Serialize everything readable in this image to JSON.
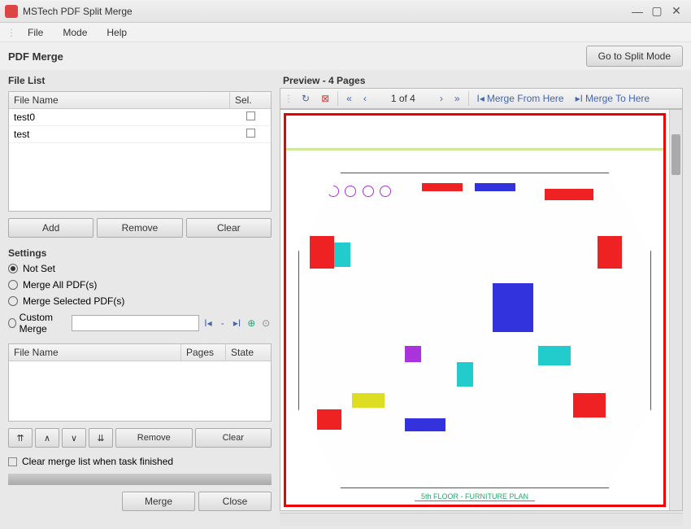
{
  "window": {
    "title": "MSTech PDF Split Merge"
  },
  "menu": {
    "file": "File",
    "mode": "Mode",
    "help": "Help"
  },
  "modebar": {
    "title": "PDF Merge",
    "split_button": "Go to Split Mode"
  },
  "filelist": {
    "heading": "File List",
    "col_name": "File Name",
    "col_sel": "Sel.",
    "rows": [
      {
        "name": "test0",
        "sel": false
      },
      {
        "name": "test",
        "sel": false
      }
    ],
    "add": "Add",
    "remove": "Remove",
    "clear": "Clear"
  },
  "settings": {
    "heading": "Settings",
    "opt_notset": "Not Set",
    "opt_all": "Merge All PDF(s)",
    "opt_selected": "Merge Selected PDF(s)",
    "opt_custom": "Custom Merge",
    "selected": "notset"
  },
  "mergelist": {
    "col_name": "File Name",
    "col_pages": "Pages",
    "col_state": "State",
    "remove": "Remove",
    "clear": "Clear"
  },
  "finish_opt": "Clear merge list when task finished",
  "bottom": {
    "merge": "Merge",
    "close": "Close"
  },
  "preview": {
    "heading": "Preview - 4 Pages",
    "page_indicator": "1 of 4",
    "merge_from": "Merge From Here",
    "merge_to": "Merge To Here",
    "caption": "5th FLOOR - FURNITURE PLAN"
  }
}
